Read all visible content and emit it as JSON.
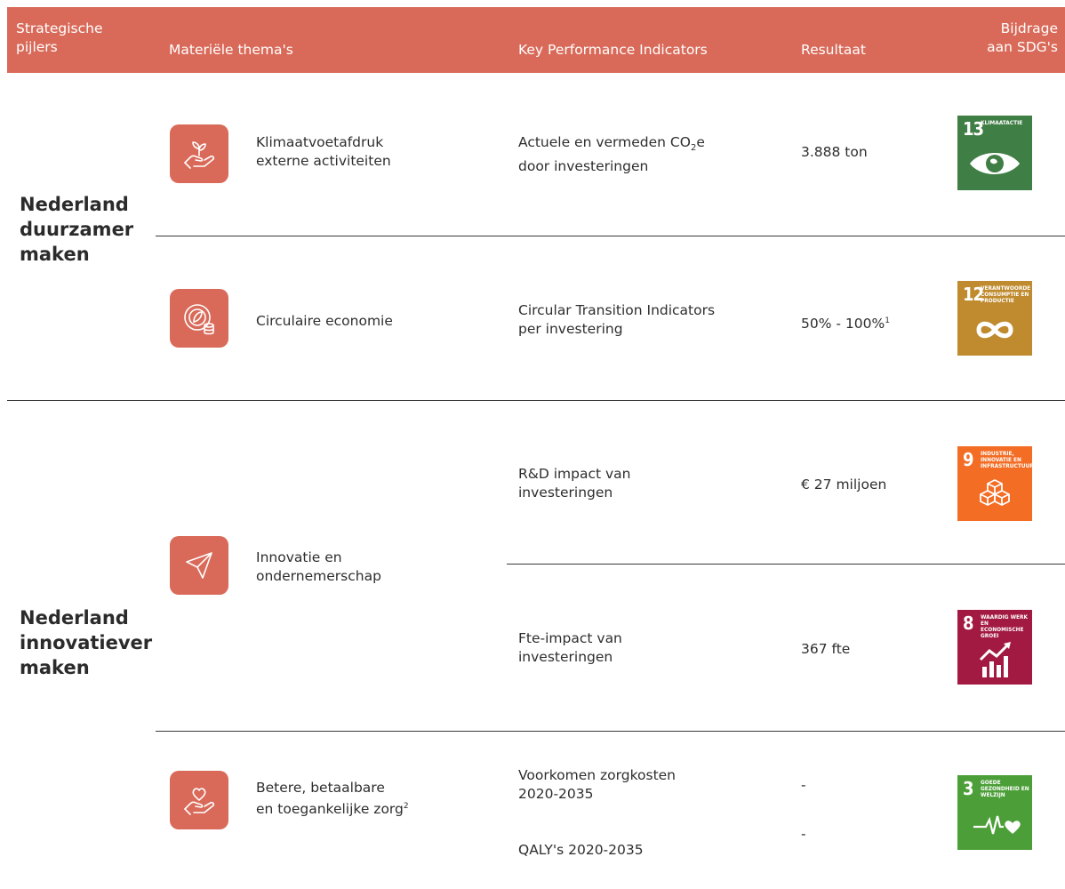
{
  "header": {
    "pillars_line1": "Strategische",
    "pillars_line2": "pijlers",
    "themes": "Materiële thema's",
    "kpis": "Key Performance Indicators",
    "result": "Resultaat",
    "sdg_line1": "Bijdrage",
    "sdg_line2": "aan SDG's"
  },
  "pillars": [
    {
      "line1": "Nederland",
      "line2": "duurzamer",
      "line3": "maken"
    },
    {
      "line1": "Nederland",
      "line2": "innovatiever",
      "line3": "maken"
    }
  ],
  "rows": [
    {
      "icon": "plant-in-hand-icon",
      "theme_line1": "Klimaatvoetafdruk",
      "theme_line2": "externe activiteiten",
      "kpi_line1_pre": "Actuele en vermeden CO",
      "kpi_line1_sub": "2",
      "kpi_line1_post": "e",
      "kpi_line2": "door investeringen",
      "result": "3.888 ton",
      "sdg": {
        "number": "13",
        "label": "KLIMAATACTIE",
        "color": "#3f7e44",
        "icon": "eye-globe-icon"
      }
    },
    {
      "icon": "circular-economy-icon",
      "theme_line1": "Circulaire economie",
      "kpi_line1": "Circular Transition Indicators",
      "kpi_line2": "per investering",
      "result": "50% - 100%",
      "result_sup": "1",
      "sdg": {
        "number": "12",
        "label": "VERANTWOORDE CONSUMPTIE EN PRODUCTIE",
        "color": "#bf8b2e",
        "icon": "infinity-icon"
      }
    },
    {
      "icon": "paper-plane-icon",
      "theme_line1": "Innovatie en",
      "theme_line2": "ondernemerschap",
      "kpi_a_line1": "R&D impact van",
      "kpi_a_line2": "investeringen",
      "result_a": "€ 27 miljoen",
      "sdg_a": {
        "number": "9",
        "label": "INDUSTRIE, INNOVATIE EN INFRASTRUCTUUR",
        "color": "#f36d25",
        "icon": "cubes-icon"
      },
      "kpi_b_line1": "Fte-impact van",
      "kpi_b_line2": "investeringen",
      "result_b": "367 fte",
      "sdg_b": {
        "number": "8",
        "label": "WAARDIG WERK EN ECONOMISCHE GROEI",
        "color": "#a21942",
        "icon": "growth-chart-icon"
      }
    },
    {
      "icon": "heart-in-hand-icon",
      "theme_line1": "Betere, betaalbare",
      "theme_line2": "en toegankelijke zorg",
      "theme_sup": "2",
      "kpi_a_line1": "Voorkomen zorgkosten",
      "kpi_a_line2": "2020-2035",
      "result_a": "-",
      "kpi_b": "QALY's 2020-2035",
      "result_b": "-",
      "sdg": {
        "number": "3",
        "label": "GOEDE GEZONDHEID EN WELZIJN",
        "color": "#4c9f38",
        "icon": "heartbeat-icon"
      }
    }
  ]
}
